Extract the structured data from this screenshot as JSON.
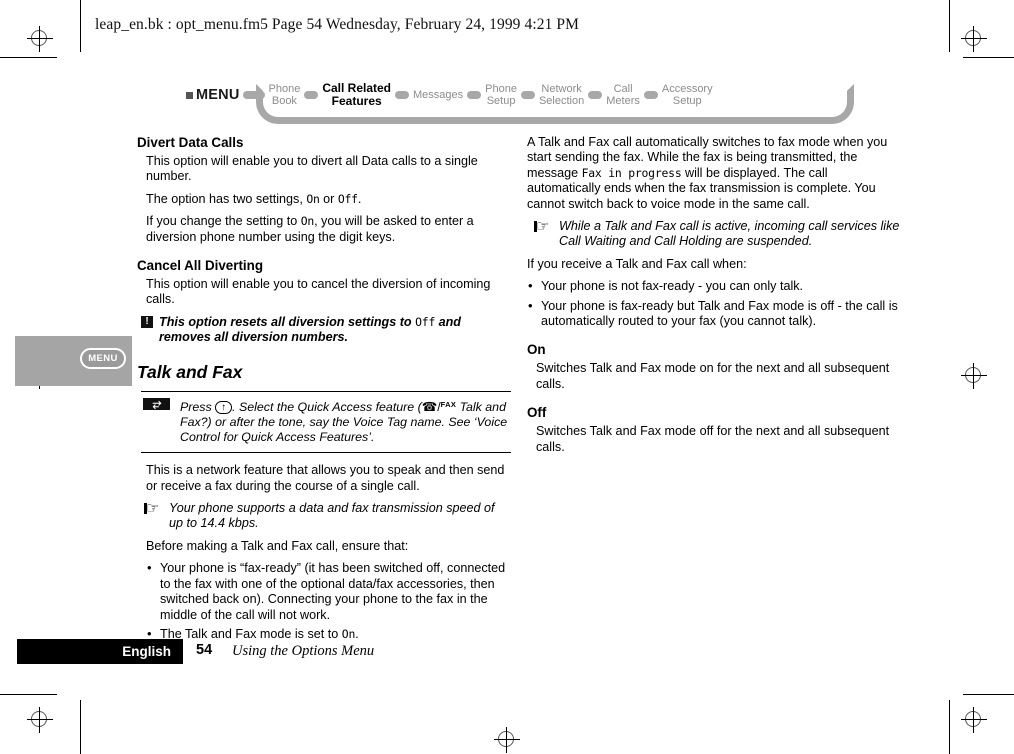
{
  "page_header": "leap_en.bk : opt_menu.fm5  Page 54  Wednesday, February 24, 1999  4:21 PM",
  "nav": {
    "menu_label": "MENU",
    "items": [
      {
        "line1": "Phone",
        "line2": "Book",
        "active": false
      },
      {
        "line1": "Call Related",
        "line2": "Features",
        "active": true
      },
      {
        "line1": "Messages",
        "line2": "",
        "active": false
      },
      {
        "line1": "Phone",
        "line2": "Setup",
        "active": false
      },
      {
        "line1": "Network",
        "line2": "Selection",
        "active": false
      },
      {
        "line1": "Call",
        "line2": "Meters",
        "active": false
      },
      {
        "line1": "Accessory",
        "line2": "Setup",
        "active": false
      }
    ]
  },
  "side_tab": {
    "key_label": "MENU"
  },
  "left_column": {
    "divert_heading": "Divert Data Calls",
    "divert_p1": "This option will enable you to divert all Data calls to a single number.",
    "divert_p2_a": "The option has two settings, ",
    "divert_p2_on": "On",
    "divert_p2_b": " or ",
    "divert_p2_off": "Off",
    "divert_p2_c": ".",
    "divert_p3_a": "If you change the setting to ",
    "divert_p3_on": "On",
    "divert_p3_b": ", you will be asked to enter a diversion phone number using the digit keys.",
    "cancel_heading": "Cancel All Diverting",
    "cancel_p1": "This option will enable you to cancel the diversion of incoming calls.",
    "cancel_warn_a": "This option resets all diversion settings to ",
    "cancel_warn_off": "Off",
    "cancel_warn_b": " and removes all diversion numbers.",
    "warn_icon": "!",
    "talkfax_heading": "Talk and Fax",
    "qa_icon": "zigzag-lightning",
    "qa_text_a": "Press ",
    "qa_key": "↑",
    "qa_text_b": ". Select the Quick Access feature (",
    "qa_phone_glyph": "☎",
    "qa_fax_sup": "FAX",
    "qa_text_c": " Talk and Fax?) or after the tone, say the Voice Tag name. See ‘Voice Control for Quick Access Features’.",
    "tf_p1": "This is a network feature that allows you to speak and then send or receive a fax during the course of a single call.",
    "tf_note": "Your phone supports a data and fax transmission speed of up to 14.4 kbps.",
    "tf_p2": "Before making a Talk and Fax call, ensure that:",
    "bullets": [
      {
        "text_a": "Your phone is “fax-ready” (it has been switched off, connected to the fax with one of the optional data/fax accessories, then switched back on). Connecting your phone to the fax in the middle of the call will not work.",
        "lcd": "",
        "text_b": ""
      },
      {
        "text_a": "The Talk and Fax mode is set to ",
        "lcd": "On",
        "text_b": "."
      }
    ]
  },
  "right_column": {
    "p1_a": "A Talk and Fax call automatically switches to fax mode when you start sending the fax. While the fax is being transmitted, the message ",
    "p1_lcd": "Fax in progress",
    "p1_b": " will be displayed. The call automatically ends when the fax transmission is complete. You cannot switch back to voice mode in the same call.",
    "note1": "While a Talk and Fax call is active, incoming call services like Call Waiting and Call Holding are suspended.",
    "p2": "If you receive a Talk and Fax call when:",
    "bullets": [
      "Your phone is not fax-ready - you can only talk.",
      "Your phone is fax-ready but Talk and Fax mode is off - the call is automatically routed to your fax (you cannot talk)."
    ],
    "on_heading": "On",
    "on_body": "Switches Talk and Fax mode on for the next and all subsequent calls.",
    "off_heading": "Off",
    "off_body": "Switches Talk and Fax mode off for the next and all subsequent calls."
  },
  "footer": {
    "language": "English",
    "page_number": "54",
    "title": "Using the Options Menu"
  }
}
